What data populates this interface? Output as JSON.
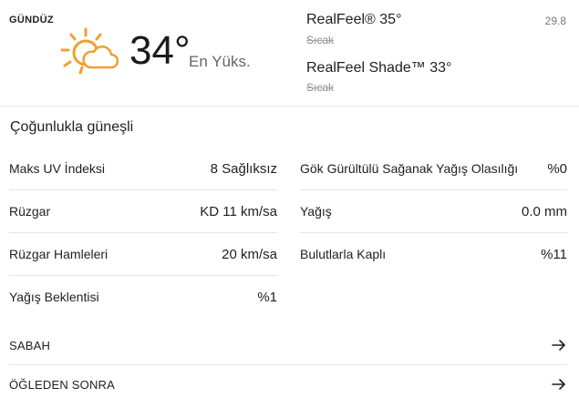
{
  "day_section": {
    "label": "GÜNDÜZ",
    "icon": "sun-behind-cloud-icon",
    "temperature": "34°",
    "temperature_label": "En Yüks.",
    "realfeel": "RealFeel® 35°",
    "realfeel_desc": "Sıcak",
    "realfeel_shade": "RealFeel Shade™ 33°",
    "realfeel_shade_desc": "Sıcak",
    "aside_value": "29.8"
  },
  "phrase": "Çoğunlukla güneşli",
  "details_left": [
    {
      "label": "Maks UV İndeksi",
      "value": "8 Sağlıksız"
    },
    {
      "label": "Rüzgar",
      "value": "KD 11 km/sa"
    },
    {
      "label": "Rüzgar Hamleleri",
      "value": "20 km/sa"
    },
    {
      "label": "Yağış Beklentisi",
      "value": "%1"
    }
  ],
  "details_right": [
    {
      "label": "Gök Gürültülü Sağanak Yağış Olasılığı",
      "value": "%0"
    },
    {
      "label": "Yağış",
      "value": "0.0 mm"
    },
    {
      "label": "Bulutlarla Kaplı",
      "value": "%11"
    }
  ],
  "nav": [
    {
      "label": "SABAH",
      "icon": "arrow-right-icon"
    },
    {
      "label": "ÖĞLEDEN SONRA",
      "icon": "arrow-right-icon"
    }
  ],
  "colors": {
    "sun": "#f0a030",
    "cloud_outline": "#f0a030",
    "text": "#1f1f1f",
    "muted": "#777777"
  }
}
